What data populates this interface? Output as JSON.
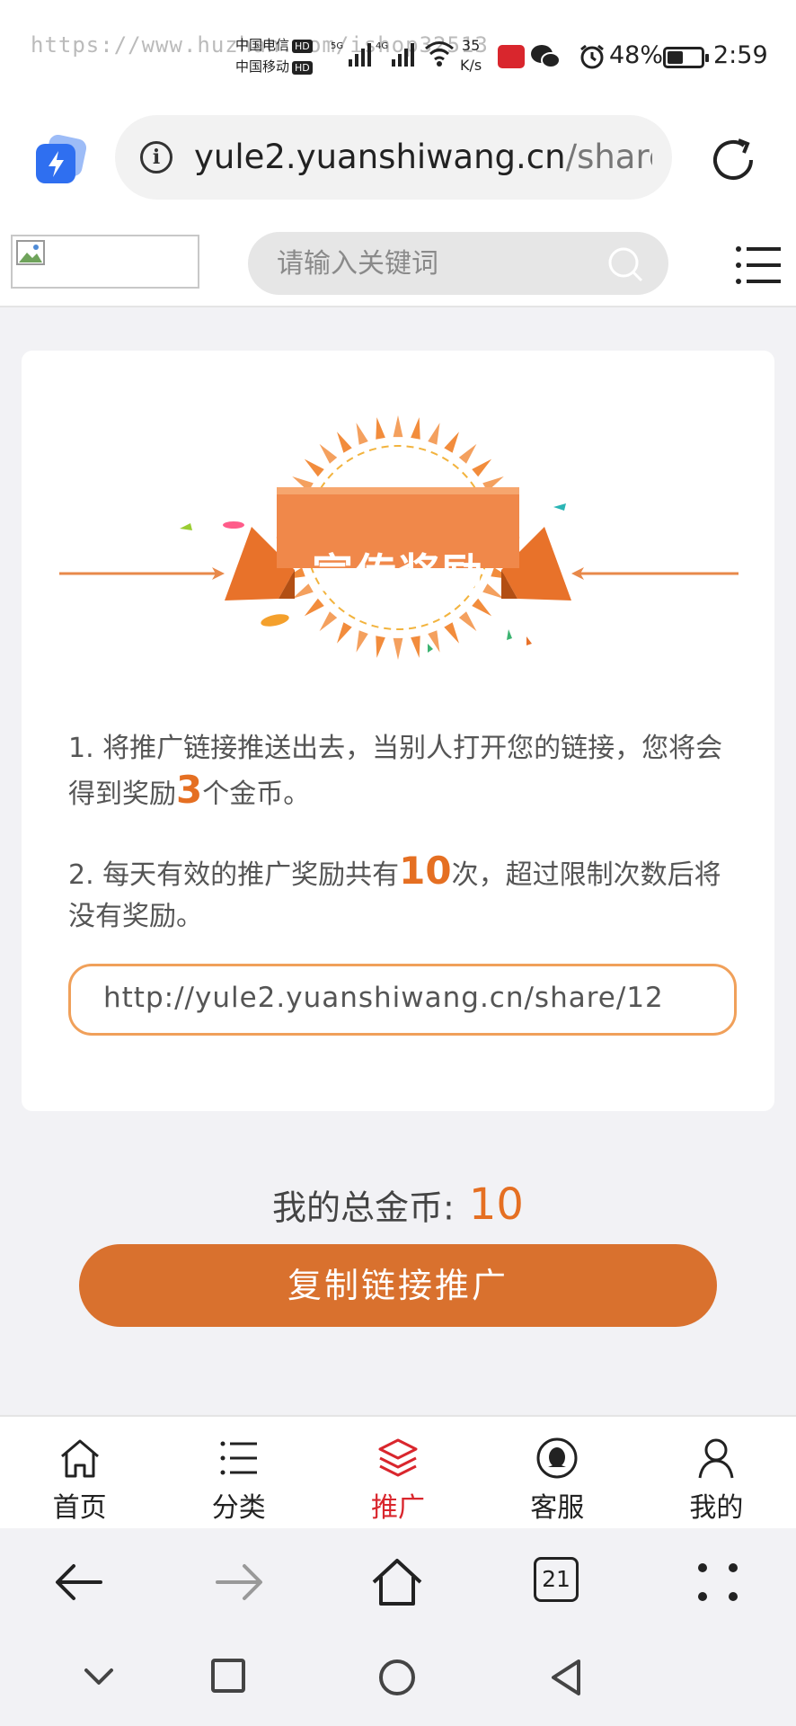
{
  "status_bar": {
    "watermark": "https://www.huzhan.com/ishop32513",
    "carrier_1": "中国电信",
    "carrier_2": "中国移动",
    "hd": "HD",
    "gen_1": "5G",
    "gen_2": "4G",
    "speed_value": "35",
    "speed_unit": "K/s",
    "battery": "48%",
    "battery_level": 0.48,
    "time": "2:59"
  },
  "browser": {
    "url_domain": "yule2.yuanshiwang.cn",
    "url_path": "/share/"
  },
  "header": {
    "search_placeholder": "请输入关键词"
  },
  "promo": {
    "banner_title": "宣传奖励",
    "rule_1_before": "1. 将推广链接推送出去，当别人打开您的链接，您将会得到奖励",
    "rule_1_value": "3",
    "rule_1_after": "个金币。",
    "rule_2_before": "2. 每天有效的推广奖励共有",
    "rule_2_value": "10",
    "rule_2_after": "次，超过限制次数后将没有奖励。",
    "share_link": "http://yule2.yuanshiwang.cn/share/12"
  },
  "total": {
    "label": "我的总金币:",
    "value": "10"
  },
  "actions": {
    "copy_button": "复制链接推广"
  },
  "tabs": [
    {
      "label": "首页",
      "icon": "home-icon"
    },
    {
      "label": "分类",
      "icon": "list-icon"
    },
    {
      "label": "推广",
      "icon": "layers-icon"
    },
    {
      "label": "客服",
      "icon": "support-icon"
    },
    {
      "label": "我的",
      "icon": "user-icon"
    }
  ],
  "browser_nav": {
    "tab_count": "21"
  },
  "colors": {
    "accent": "#d9712e",
    "highlight": "#e56f22",
    "active_tab": "#d9262d"
  }
}
